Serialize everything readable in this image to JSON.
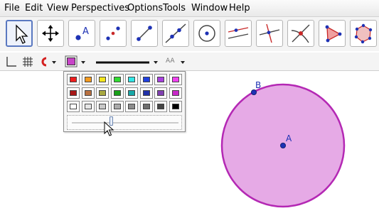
{
  "menu": {
    "file": "File",
    "edit": "Edit",
    "view": "View",
    "perspectives": "Perspectives",
    "options": "Options",
    "tools": "Tools",
    "window": "Window",
    "help": "Help"
  },
  "toolbar": {
    "move_label": "A",
    "selected_tool": "move"
  },
  "stylebar": {
    "label_style_text": "AA",
    "selected_color": "#c844c8"
  },
  "color_popup": {
    "rows": [
      [
        "#f01e1e",
        "#f59a1e",
        "#f5e61e",
        "#32dc32",
        "#32e6e6",
        "#2040e0",
        "#a840e0",
        "#f040f0"
      ],
      [
        "#a81818",
        "#b87040",
        "#a8a840",
        "#18a018",
        "#18a8a8",
        "#2030a8",
        "#8040b0",
        "#c828c8"
      ],
      [
        "#ffffff",
        "#e6e6e6",
        "#c8c8c8",
        "#aaaaaa",
        "#8c8c8c",
        "#6e6e6e",
        "#464646",
        "#000000"
      ]
    ],
    "opacity_fraction": 0.375
  },
  "graphics": {
    "point_a_label": "A",
    "point_b_label": "B",
    "circle_fill": "#e6aae6",
    "circle_stroke": "#b428b4",
    "point_color": "#1e32b4"
  }
}
